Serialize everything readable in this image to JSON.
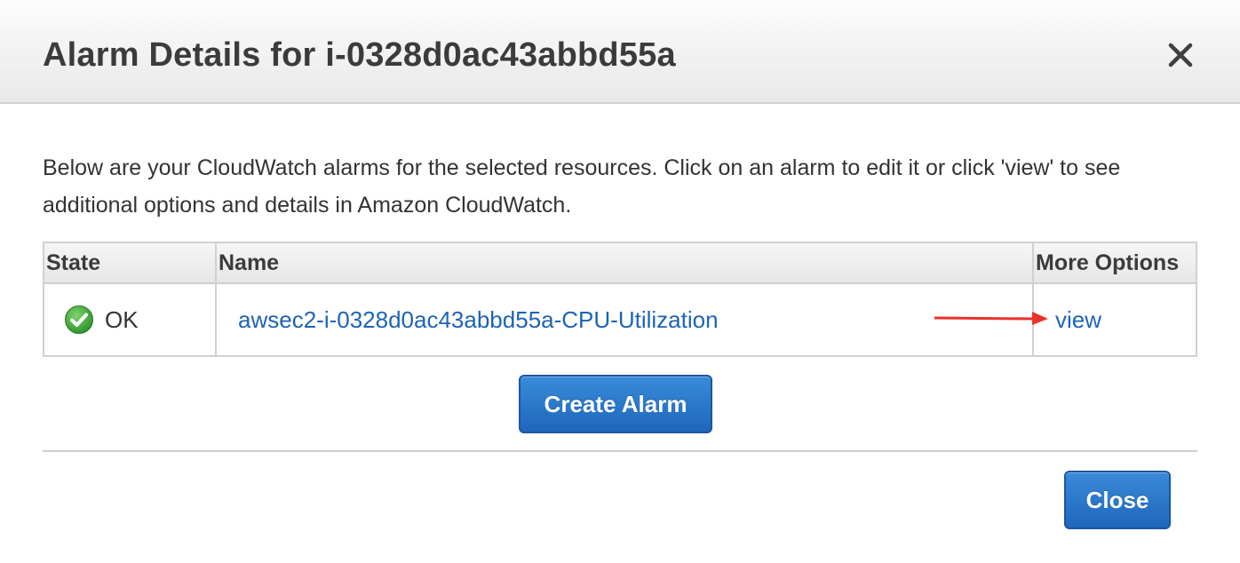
{
  "dialog": {
    "title": "Alarm Details for i-0328d0ac43abbd55a",
    "close_icon": "close-x-icon",
    "intro_text": "Below are your CloudWatch alarms for the selected resources. Click on an alarm to edit it or click 'view' to see additional options and details in Amazon CloudWatch."
  },
  "table": {
    "columns": [
      "State",
      "Name",
      "More Options"
    ],
    "rows": [
      {
        "state_icon": "check-circle-icon",
        "state": "OK",
        "name": "awsec2-i-0328d0ac43abbd55a-CPU-Utilization",
        "option": "view"
      }
    ]
  },
  "annotation": {
    "arrow_color": "#e8322a"
  },
  "buttons": {
    "create_alarm": "Create Alarm",
    "close": "Close"
  },
  "colors": {
    "link": "#1d64b3",
    "button": "#2a78cc",
    "ok_green": "#3aa33a"
  }
}
